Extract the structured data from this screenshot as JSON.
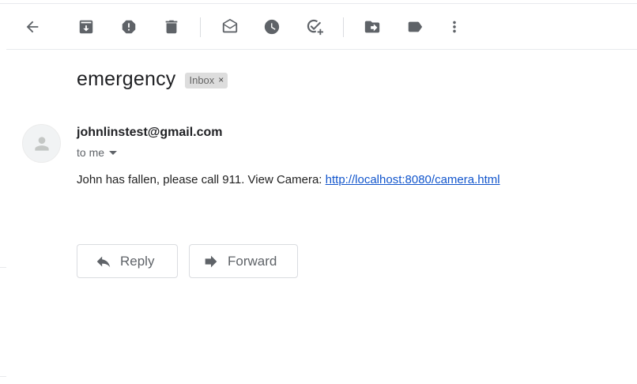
{
  "toolbar": {
    "buttons": [
      {
        "name": "back-button",
        "icon": "arrow-back-icon"
      },
      {
        "name": "archive-button",
        "icon": "archive-icon"
      },
      {
        "name": "report-spam-button",
        "icon": "report-spam-icon"
      },
      {
        "name": "delete-button",
        "icon": "trash-icon"
      },
      {
        "name": "mark-unread-button",
        "icon": "mark-unread-icon"
      },
      {
        "name": "snooze-button",
        "icon": "clock-icon"
      },
      {
        "name": "add-to-tasks-button",
        "icon": "add-task-icon"
      },
      {
        "name": "move-to-button",
        "icon": "move-to-icon"
      },
      {
        "name": "labels-button",
        "icon": "label-icon"
      },
      {
        "name": "more-button",
        "icon": "more-vert-icon"
      }
    ]
  },
  "email": {
    "subject": "emergency",
    "label": "Inbox",
    "label_remove": "×",
    "sender": "johnlinstest@gmail.com",
    "recipient": "to me",
    "body_text": "John has fallen, please call 911. View Camera: ",
    "body_link": "http://localhost:8080/camera.html"
  },
  "actions": {
    "reply_label": "Reply",
    "forward_label": "Forward"
  },
  "colors": {
    "link": "#1155cc",
    "icon": "#5f6368",
    "divider": "#e8eaed"
  }
}
